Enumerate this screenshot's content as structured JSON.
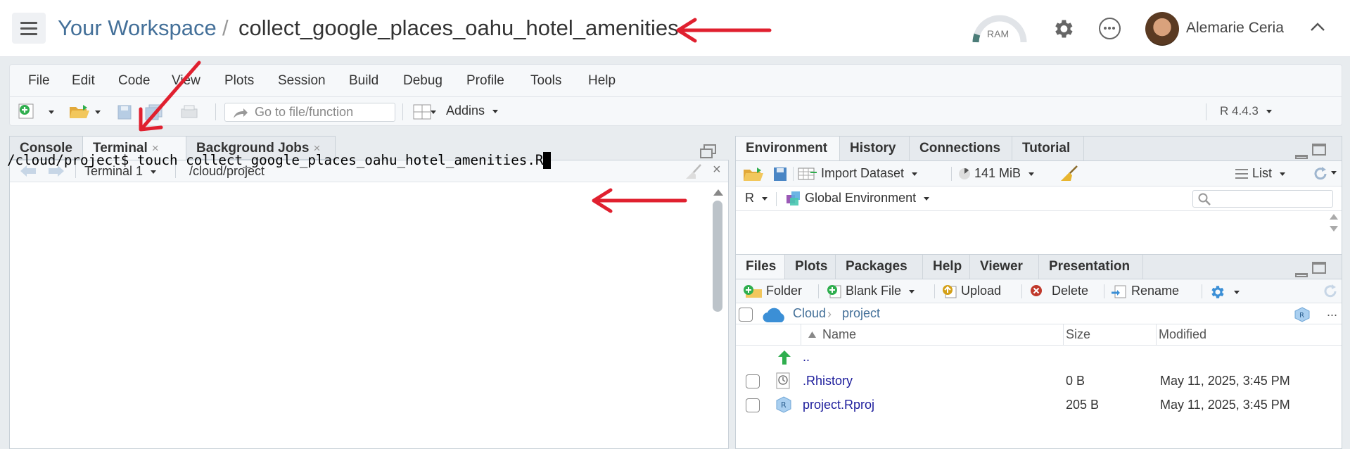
{
  "header": {
    "workspace_label": "Your Workspace",
    "separator": "/",
    "project_title": "collect_google_places_oahu_hotel_amenities",
    "ram_label": "RAM",
    "user_name": "Alemarie Ceria"
  },
  "menubar": {
    "items": [
      "File",
      "Edit",
      "Code",
      "View",
      "Plots",
      "Session",
      "Build",
      "Debug",
      "Profile",
      "Tools",
      "Help"
    ]
  },
  "toolbar": {
    "goto_placeholder": "Go to file/function",
    "addins_label": "Addins",
    "r_version": "R 4.4.3"
  },
  "left_pane": {
    "tabs": [
      {
        "label": "Console"
      },
      {
        "label": "Terminal",
        "close": "×"
      },
      {
        "label": "Background Jobs",
        "close": "×"
      }
    ],
    "terminal_selector": "Terminal 1",
    "working_dir": "/cloud/project",
    "terminal_prompt": "/cloud/project$ ",
    "terminal_command": "touch collect_google_places_oahu_hotel_amenities.R"
  },
  "env_pane": {
    "tabs": [
      "Environment",
      "History",
      "Connections",
      "Tutorial"
    ],
    "import_dataset": "Import Dataset",
    "memory": "141 MiB",
    "view_mode": "List",
    "language": "R",
    "scope": "Global Environment"
  },
  "files_pane": {
    "tabs": [
      "Files",
      "Plots",
      "Packages",
      "Help",
      "Viewer",
      "Presentation"
    ],
    "actions": {
      "folder": "Folder",
      "blank_file": "Blank File",
      "upload": "Upload",
      "delete": "Delete",
      "rename": "Rename"
    },
    "more": "...",
    "breadcrumb": {
      "root": "Cloud",
      "sep": "›",
      "current": "project"
    },
    "columns": {
      "name": "Name",
      "size": "Size",
      "modified": "Modified"
    },
    "rows": [
      {
        "name": "..",
        "size": "",
        "modified": ""
      },
      {
        "name": ".Rhistory",
        "size": "0 B",
        "modified": "May 11, 2025, 3:45 PM"
      },
      {
        "name": "project.Rproj",
        "size": "205 B",
        "modified": "May 11, 2025, 3:45 PM"
      }
    ]
  },
  "colors": {
    "workspace_link": "#447099",
    "annotation_arrow": "#e0202f",
    "file_link": "#1d1d9c",
    "pane_border": "#c9d1d8"
  }
}
